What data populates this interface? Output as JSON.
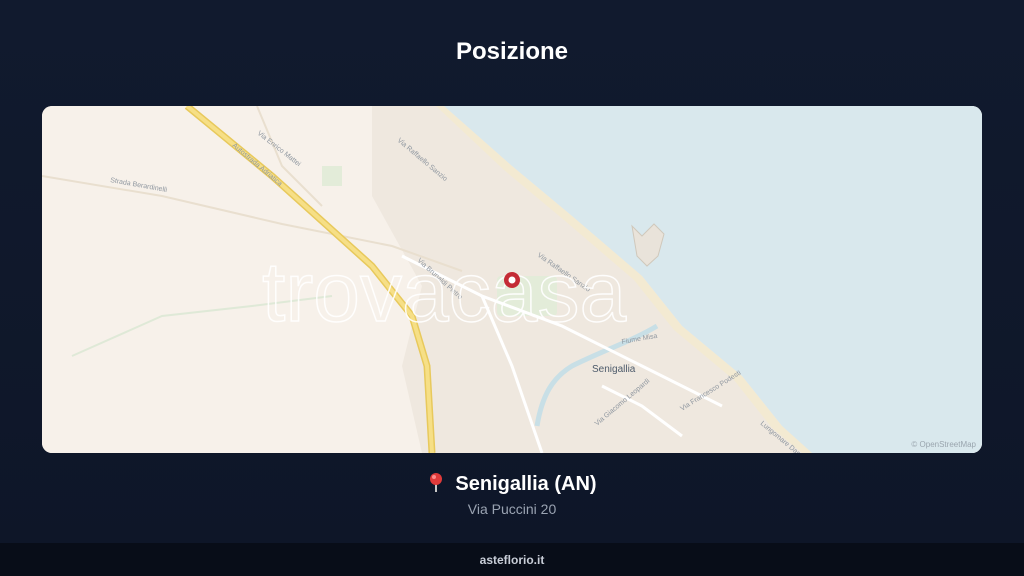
{
  "header": {
    "title": "Posizione"
  },
  "map": {
    "watermark": "trovacasa",
    "attribution": "© OpenStreetMap",
    "city_label": "Senigallia",
    "streets": [
      "Via Enrico Mattei",
      "Via Raffaello Sanzio",
      "Autostrada Adriatica",
      "Strada Berardinelli",
      "Via Raffaello Sanzio",
      "Via Brunaldi Pietro",
      "Fiume Misa",
      "Via Giacomo Leopardi",
      "Via Francesco Podesti",
      "Lungomare Dante"
    ],
    "colors": {
      "sea": "#d9e8ed",
      "land": "#f7f1ea",
      "highway": "#f2d77a",
      "marker": "#c42b35"
    }
  },
  "location": {
    "pin_icon": "pin-icon",
    "name": "Senigallia (AN)",
    "address": "Via Puccini 20"
  },
  "footer": {
    "site": "asteflorio.it"
  }
}
